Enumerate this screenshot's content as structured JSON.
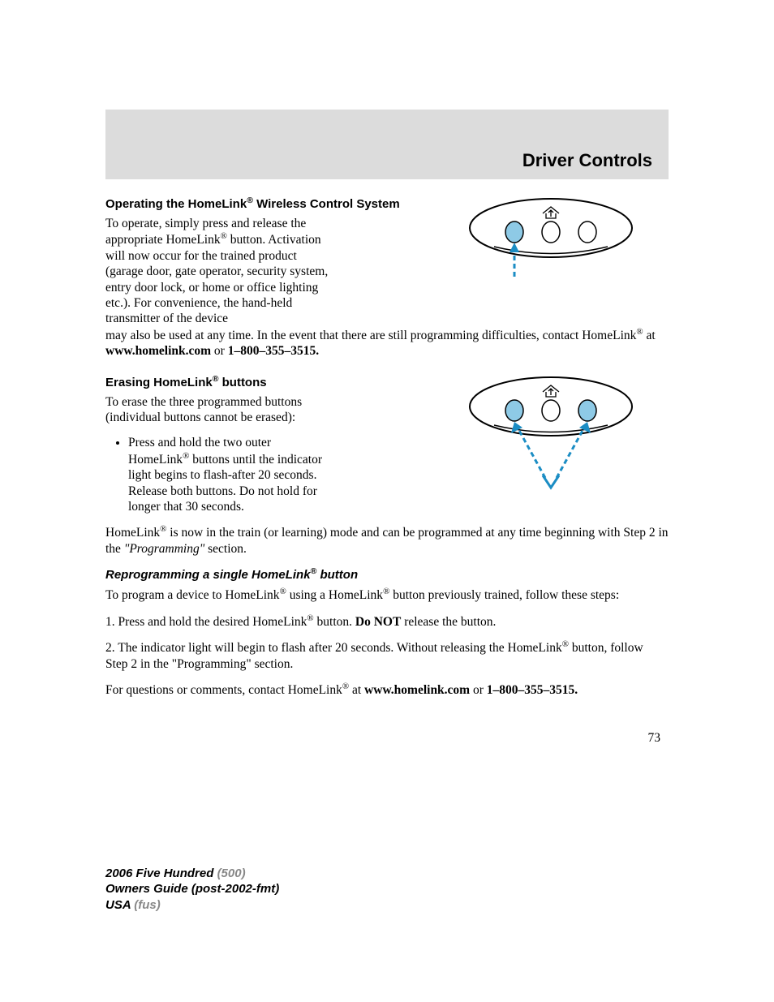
{
  "header": {
    "title": "Driver Controls"
  },
  "sections": {
    "operating": {
      "heading_pre": "Operating the HomeLink",
      "heading_post": " Wireless Control System",
      "para1_pre": "To operate, simply press and release the appropriate HomeLink",
      "para1_post": " button. Activation will now occur for the trained product (garage door, gate operator, security system, entry door lock, or home or office lighting etc.). For convenience, the hand-held transmitter of the device",
      "para1_cont_pre": "may also be used at any time. In the event that there are still programming difficulties, contact HomeLink",
      "para1_cont_mid": " at ",
      "para1_url": "www.homelink.com",
      "para1_or": " or ",
      "para1_phone": "1–800–355–3515."
    },
    "erasing": {
      "heading_pre": "Erasing HomeLink",
      "heading_post": " buttons",
      "para1": "To erase the three programmed buttons (individual buttons cannot be erased):",
      "bullet_pre": "Press and hold the two outer HomeLink",
      "bullet_post": " buttons until the indicator light begins to flash-after 20 seconds. Release both buttons. Do not hold for longer that 30 seconds.",
      "para2_pre": "HomeLink",
      "para2_mid": " is now in the train (or learning) mode and can be programmed at any time beginning with Step 2 in the ",
      "para2_italic": "\"Programming\"",
      "para2_end": " section."
    },
    "reprogram": {
      "heading_pre": "Reprogramming a single HomeLink",
      "heading_post": " button",
      "para1_pre": "To program a device to HomeLink",
      "para1_mid": " using a HomeLink",
      "para1_post": " button previously trained, follow these steps:",
      "step1_pre": "1. Press and hold the desired HomeLink",
      "step1_mid": " button. ",
      "step1_bold": "Do NOT",
      "step1_post": " release the button.",
      "step2_pre": "2. The indicator light will begin to flash after 20 seconds. Without releasing the HomeLink",
      "step2_post": " button, follow Step 2 in the \"Programming\" section.",
      "para_final_pre": "For questions or comments, contact HomeLink",
      "para_final_mid": " at ",
      "para_final_url": "www.homelink.com",
      "para_final_or": " or ",
      "para_final_phone": "1–800–355–3515."
    }
  },
  "page_number": "73",
  "footer": {
    "line1a": "2006 Five Hundred ",
    "line1b": "(500)",
    "line2": "Owners Guide (post-2002-fmt)",
    "line3a": "USA ",
    "line3b": "(fus)"
  },
  "colors": {
    "button_fill": "#8ecae6",
    "arrow": "#1b8dc4"
  },
  "reg_symbol": "®"
}
